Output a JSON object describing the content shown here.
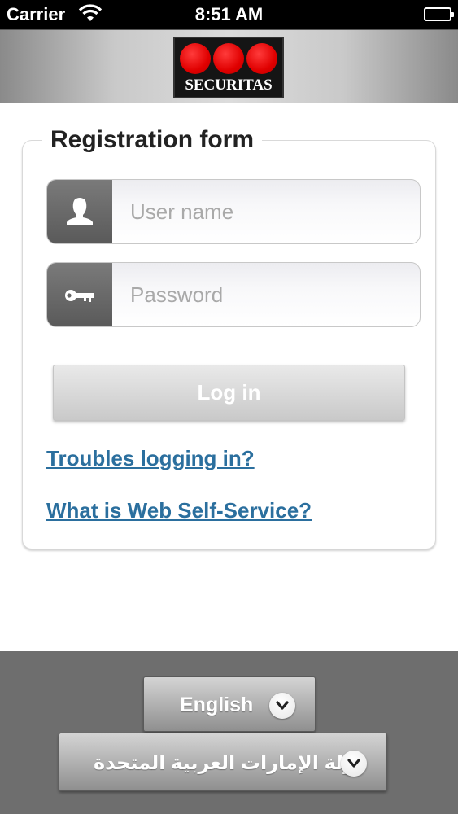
{
  "status_bar": {
    "carrier": "Carrier",
    "time": "8:51 AM",
    "icons": [
      "wifi-icon",
      "battery-icon"
    ]
  },
  "header": {
    "logo_text": "SECURITAS",
    "logo_colors": {
      "dots": "#e00000",
      "background": "#151515"
    }
  },
  "form": {
    "title": "Registration form",
    "username": {
      "value": "",
      "placeholder": "User name",
      "icon": "user-icon"
    },
    "password": {
      "value": "",
      "placeholder": "Password",
      "icon": "key-icon"
    },
    "login_label": "Log in",
    "links": {
      "troubles": "Troubles logging in?",
      "what_is": "What is Web Self-Service?"
    },
    "link_color": "#2b6f9e"
  },
  "footer": {
    "language": {
      "selected": "English",
      "icon": "chevron-down-icon"
    },
    "country": {
      "selected": "دولة الإمارات العربية المتحدة",
      "icon": "chevron-down-icon"
    }
  }
}
